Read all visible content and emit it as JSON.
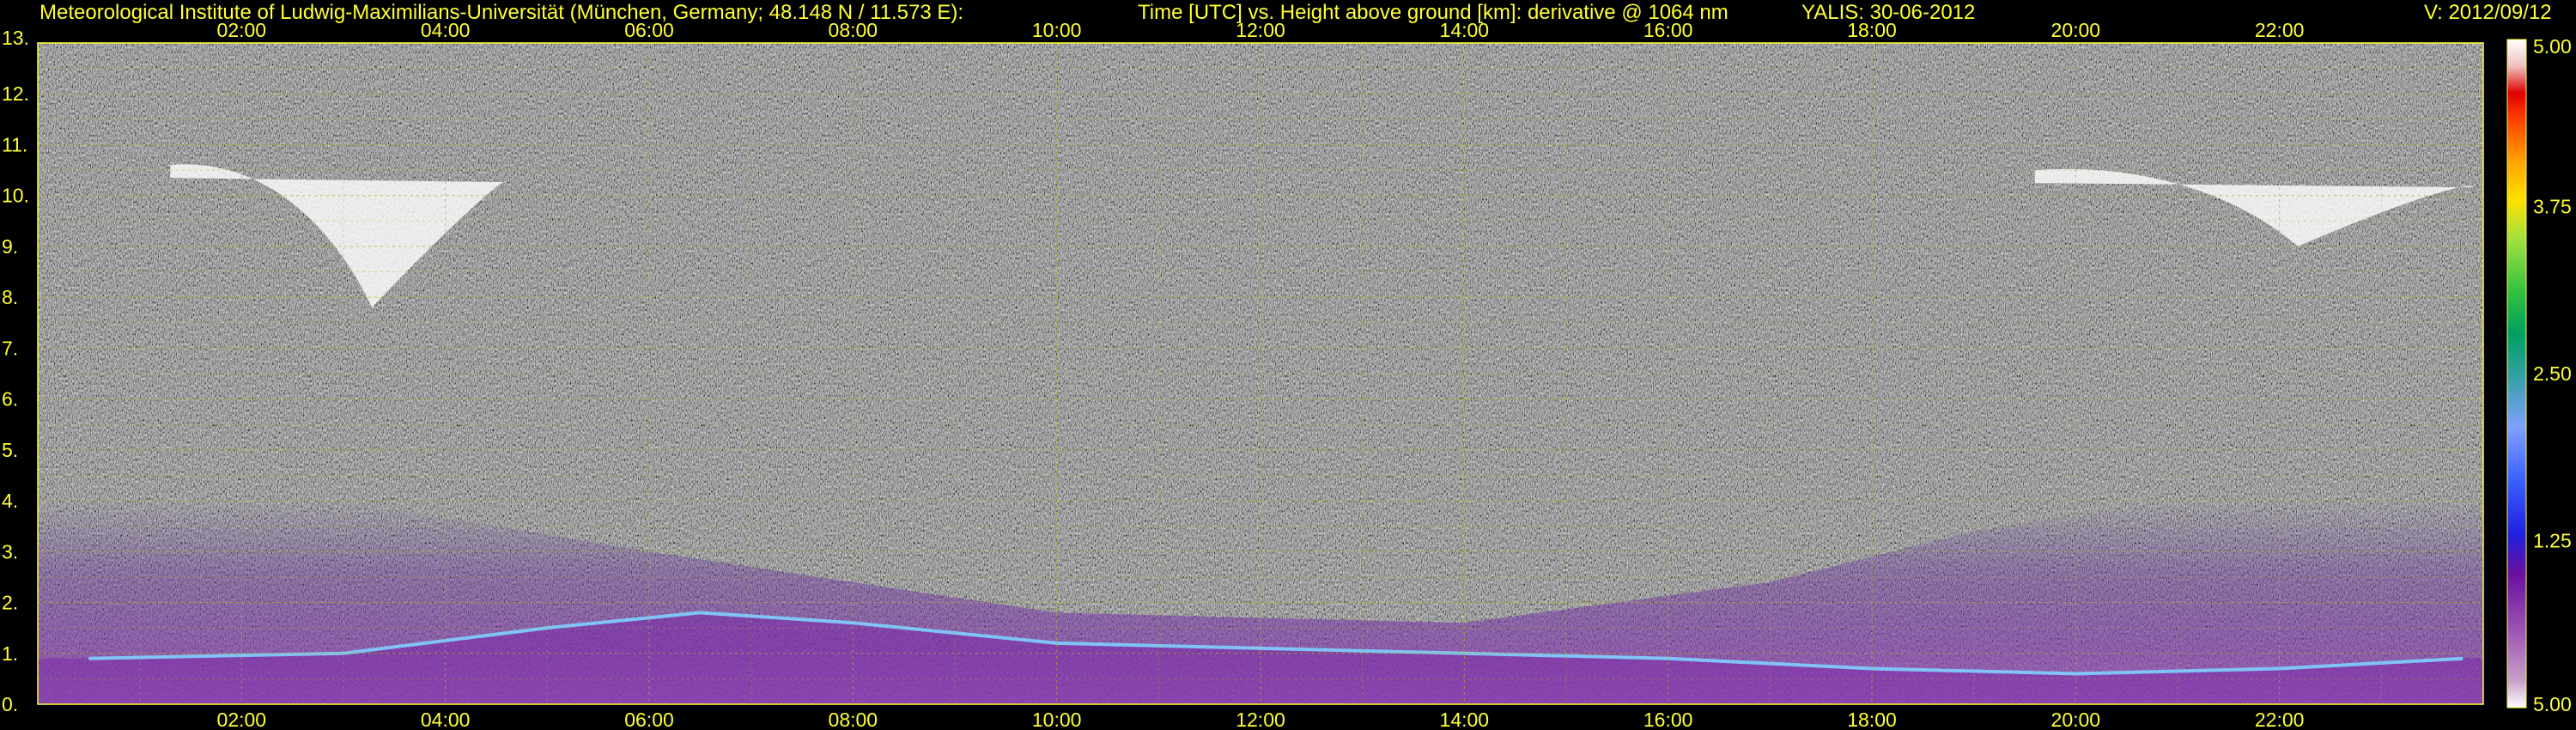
{
  "header": {
    "institute": "Meteorological Institute of Ludwig-Maximilians-Universität (München, Germany; 48.148 N / 11.573 E):",
    "title": "Time [UTC] vs. Height above ground [km]: derivative @ 1064 nm",
    "instrument_date": "YALIS: 30-06-2012",
    "version": "V: 2012/09/12"
  },
  "chart_data": {
    "type": "heatmap",
    "title": "Time [UTC] vs. Height above ground [km]: derivative @ 1064 nm",
    "xlabel": "Time [UTC]",
    "ylabel": "Height above ground [km]",
    "xlim": [
      0,
      24
    ],
    "ylim": [
      0,
      13
    ],
    "x_tick_labels": [
      "02:00",
      "04:00",
      "06:00",
      "08:00",
      "10:00",
      "12:00",
      "14:00",
      "16:00",
      "18:00",
      "20:00",
      "22:00"
    ],
    "x_tick_values": [
      2,
      4,
      6,
      8,
      10,
      12,
      14,
      16,
      18,
      20,
      22
    ],
    "y_tick_labels": [
      "0.",
      "1.",
      "2.",
      "3.",
      "4.",
      "5.",
      "6.",
      "7.",
      "8.",
      "9.",
      "10.",
      "11.",
      "12.",
      "13."
    ],
    "y_tick_values": [
      0,
      1,
      2,
      3,
      4,
      5,
      6,
      7,
      8,
      9,
      10,
      11,
      12,
      13
    ],
    "grid": true,
    "colorbar": {
      "range": [
        0,
        5
      ],
      "tick_labels": [
        "5.00",
        "3.75",
        "2.50",
        "1.25",
        "5.00"
      ],
      "tick_values": [
        5.0,
        3.75,
        2.5,
        1.25,
        0.0
      ]
    },
    "features": {
      "boundary_layer_top_km": [
        {
          "x": 0.5,
          "y": 0.9
        },
        {
          "x": 3.0,
          "y": 1.0
        },
        {
          "x": 5.0,
          "y": 1.5
        },
        {
          "x": 6.5,
          "y": 1.8
        },
        {
          "x": 8.0,
          "y": 1.6
        },
        {
          "x": 10.0,
          "y": 1.2
        },
        {
          "x": 12.0,
          "y": 1.1
        },
        {
          "x": 14.0,
          "y": 1.0
        },
        {
          "x": 16.0,
          "y": 0.9
        },
        {
          "x": 18.0,
          "y": 0.7
        },
        {
          "x": 20.0,
          "y": 0.6
        },
        {
          "x": 22.0,
          "y": 0.7
        },
        {
          "x": 23.8,
          "y": 0.9
        }
      ],
      "aerosol_layer_top_km": 4.0,
      "cirrus_clouds": [
        {
          "x_start": 1.3,
          "x_end": 4.6,
          "y_bottom": 7.8,
          "y_top": 10.6
        },
        {
          "x_start": 19.6,
          "x_end": 23.9,
          "y_bottom": 9.0,
          "y_top": 10.5
        }
      ]
    }
  }
}
